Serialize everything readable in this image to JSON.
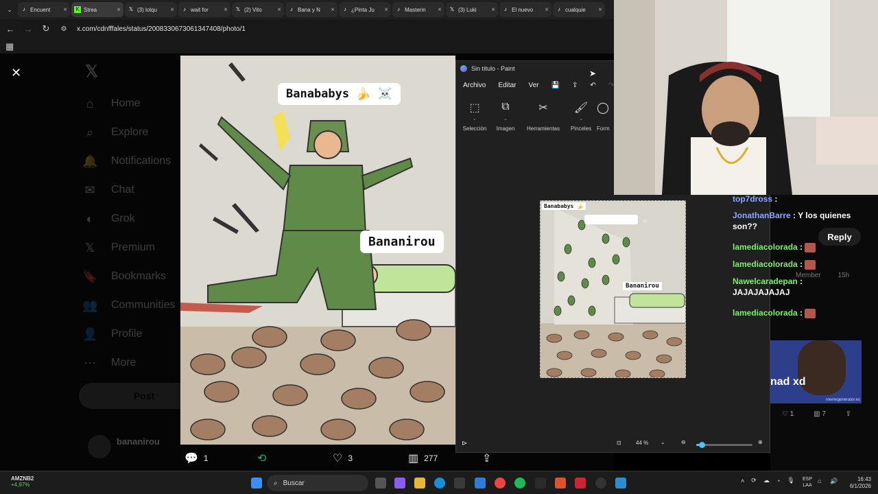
{
  "browser": {
    "tabs": [
      {
        "label": "Encuent",
        "icon": "tiktok-icon"
      },
      {
        "label": "Strea",
        "icon": "kick-icon"
      },
      {
        "label": "(3) lolqu",
        "icon": "x-icon"
      },
      {
        "label": "wait for",
        "icon": "tiktok-icon"
      },
      {
        "label": "(2) Vito",
        "icon": "x-icon"
      },
      {
        "label": "Bana y N",
        "icon": "tiktok-icon"
      },
      {
        "label": "¿Pinta Ju",
        "icon": "tiktok-icon"
      },
      {
        "label": "Masterin",
        "icon": "tiktok-icon"
      },
      {
        "label": "(3) Luki",
        "icon": "x-icon"
      },
      {
        "label": "El nuevo",
        "icon": "tiktok-icon"
      },
      {
        "label": "cualquie",
        "icon": "tiktok-icon"
      }
    ],
    "url": "x.com/cdnfffales/status/2008330673061347408/photo/1"
  },
  "x_sidebar": {
    "items": [
      {
        "label": "Home",
        "icon": "home-icon"
      },
      {
        "label": "Explore",
        "icon": "search-icon"
      },
      {
        "label": "Notifications",
        "icon": "bell-icon"
      },
      {
        "label": "Chat",
        "icon": "chat-icon"
      },
      {
        "label": "Grok",
        "icon": "grok-icon"
      },
      {
        "label": "Premium",
        "icon": "x-icon"
      },
      {
        "label": "Bookmarks",
        "icon": "bookmark-icon"
      },
      {
        "label": "Communities",
        "icon": "people-icon"
      },
      {
        "label": "Profile",
        "icon": "person-icon"
      },
      {
        "label": "More",
        "icon": "more-icon"
      }
    ],
    "post_label": "Post",
    "account_name": "bananirou"
  },
  "meme": {
    "label_top": "Banababys 🍌 ☠️",
    "label_bottom": "Bananirou"
  },
  "tweet_actions": {
    "replies": "1",
    "reposts": "",
    "likes": "3",
    "views": "277"
  },
  "paint": {
    "title": "Sin título - Paint",
    "menu": [
      "Archivo",
      "Editar",
      "Ver"
    ],
    "tools": [
      "Selección",
      "Imagen",
      "Herramientas",
      "Pinceles",
      "Form"
    ],
    "canvas_label_top": "Banababys 🍌",
    "canvas_label_bottom": "Bananirou",
    "zoom": "44 %",
    "zoom_level": 0.1
  },
  "chat": {
    "messages": [
      {
        "user": "top7dross",
        "text": "",
        "color": "blue"
      },
      {
        "user": "JonathanBarre",
        "text": "Y los quienes son??",
        "color": "blue"
      },
      {
        "user": "lamediacolorada",
        "text": "",
        "color": "green"
      },
      {
        "user": "lamediacolorada",
        "text": "",
        "color": "green"
      },
      {
        "user": "Nawelcaradepan",
        "text": "JAJAJAJAJAJ",
        "color": "green"
      },
      {
        "user": "lamediacolorada",
        "text": "",
        "color": "green"
      }
    ],
    "reply_label": "Reply",
    "member_label": "Member",
    "member_time": "15h",
    "thumb_caption": "nad xd",
    "thumb_watermark": "memegenerator.es",
    "likes": "1",
    "views": "7"
  },
  "taskbar": {
    "stock_name": "AMZNB2",
    "stock_change": "+4,97%",
    "search_placeholder": "Buscar",
    "lang_top": "ESP",
    "lang_bottom": "LAA",
    "time": "16:43",
    "date": "6/1/2026"
  }
}
